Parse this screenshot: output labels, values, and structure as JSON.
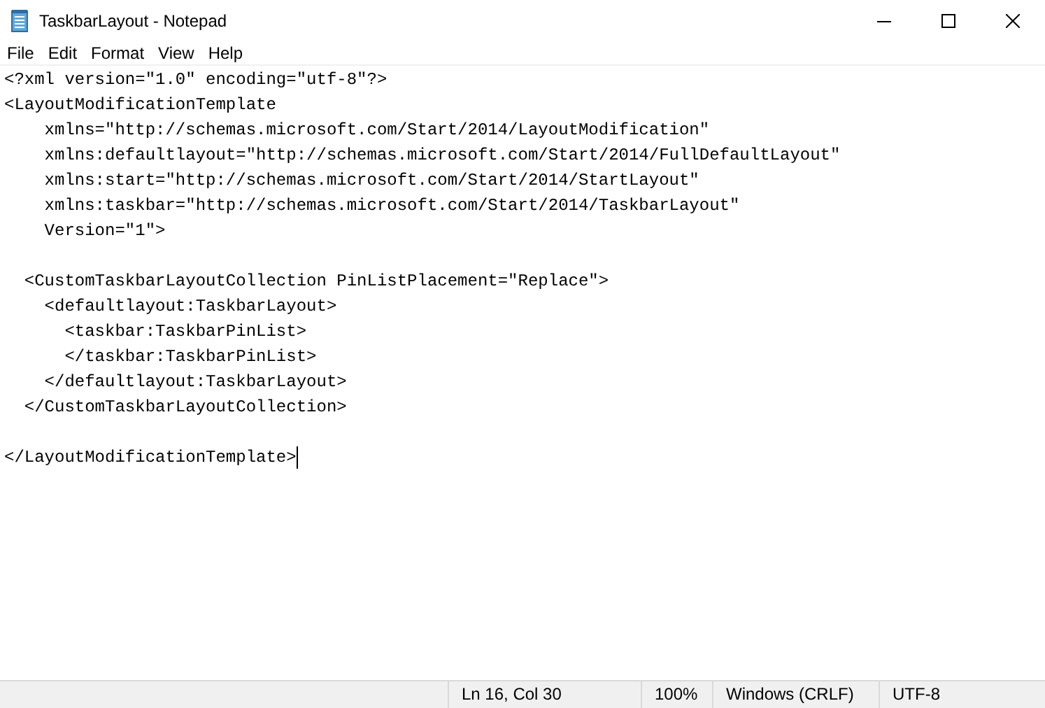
{
  "window": {
    "title": "TaskbarLayout - Notepad",
    "controls": [
      {
        "kind": "minimize"
      },
      {
        "kind": "maximize"
      },
      {
        "kind": "close"
      }
    ]
  },
  "menu": [
    "File",
    "Edit",
    "Format",
    "View",
    "Help"
  ],
  "editor": {
    "lines": [
      {
        "kind": "text",
        "text": "<?xml version=\"1.0\" encoding=\"utf-8\"?>"
      },
      {
        "kind": "text",
        "text": "<LayoutModificationTemplate"
      },
      {
        "kind": "text",
        "text": "    xmlns=\"http://schemas.microsoft.com/Start/2014/LayoutModification\""
      },
      {
        "kind": "text",
        "text": "    xmlns:defaultlayout=\"http://schemas.microsoft.com/Start/2014/FullDefaultLayout\""
      },
      {
        "kind": "text",
        "text": "    xmlns:start=\"http://schemas.microsoft.com/Start/2014/StartLayout\""
      },
      {
        "kind": "text",
        "text": "    xmlns:taskbar=\"http://schemas.microsoft.com/Start/2014/TaskbarLayout\""
      },
      {
        "kind": "text",
        "text": "    Version=\"1\">"
      },
      {
        "kind": "blank"
      },
      {
        "kind": "text",
        "text": "  <CustomTaskbarLayoutCollection PinListPlacement=\"Replace\">"
      },
      {
        "kind": "text",
        "text": "    <defaultlayout:TaskbarLayout>"
      },
      {
        "kind": "text",
        "text": "      <taskbar:TaskbarPinList>"
      },
      {
        "kind": "text",
        "text": "      </taskbar:TaskbarPinList>"
      },
      {
        "kind": "text",
        "text": "    </defaultlayout:TaskbarLayout>"
      },
      {
        "kind": "text",
        "text": "  </CustomTaskbarLayoutCollection>"
      },
      {
        "kind": "blank"
      },
      {
        "kind": "text",
        "text": "</LayoutModificationTemplate>",
        "caret": true
      }
    ]
  },
  "status_bar": {
    "position": "Ln 16, Col 30",
    "zoom": "100%",
    "line_ending": "Windows (CRLF)",
    "encoding": "UTF-8"
  }
}
